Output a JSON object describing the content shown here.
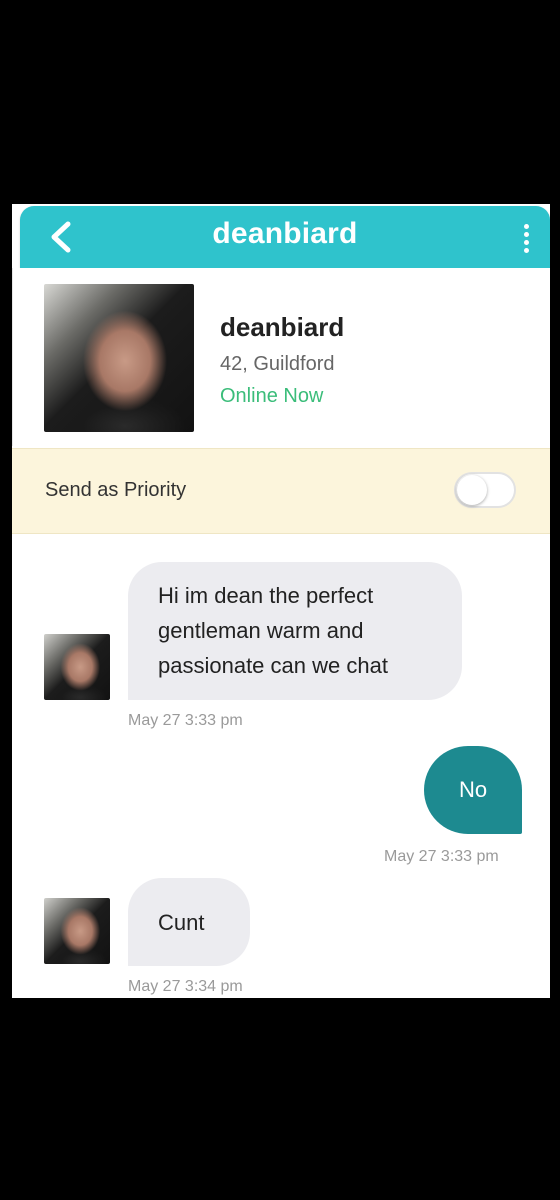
{
  "header": {
    "title": "deanbiard",
    "back_icon": "chevron-left-icon",
    "menu_icon": "vertical-dots-icon",
    "bar_color": "#2fc3cc"
  },
  "profile": {
    "username": "deanbiard",
    "age_location": "42, Guildford",
    "status": "Online Now",
    "status_color": "#3bbd7a"
  },
  "priority": {
    "label": "Send as Priority",
    "toggle_on": false,
    "band_color": "#fcf5dc"
  },
  "messages": [
    {
      "direction": "incoming",
      "text": "Hi im dean the perfect gentleman warm and passionate can we chat",
      "time": "May 27 3:33 pm"
    },
    {
      "direction": "outgoing",
      "text": "No",
      "time": "May 27 3:33 pm",
      "bubble_color": "#1d8a90"
    },
    {
      "direction": "incoming",
      "text": "Cunt",
      "time": "May 27 3:34 pm"
    }
  ]
}
